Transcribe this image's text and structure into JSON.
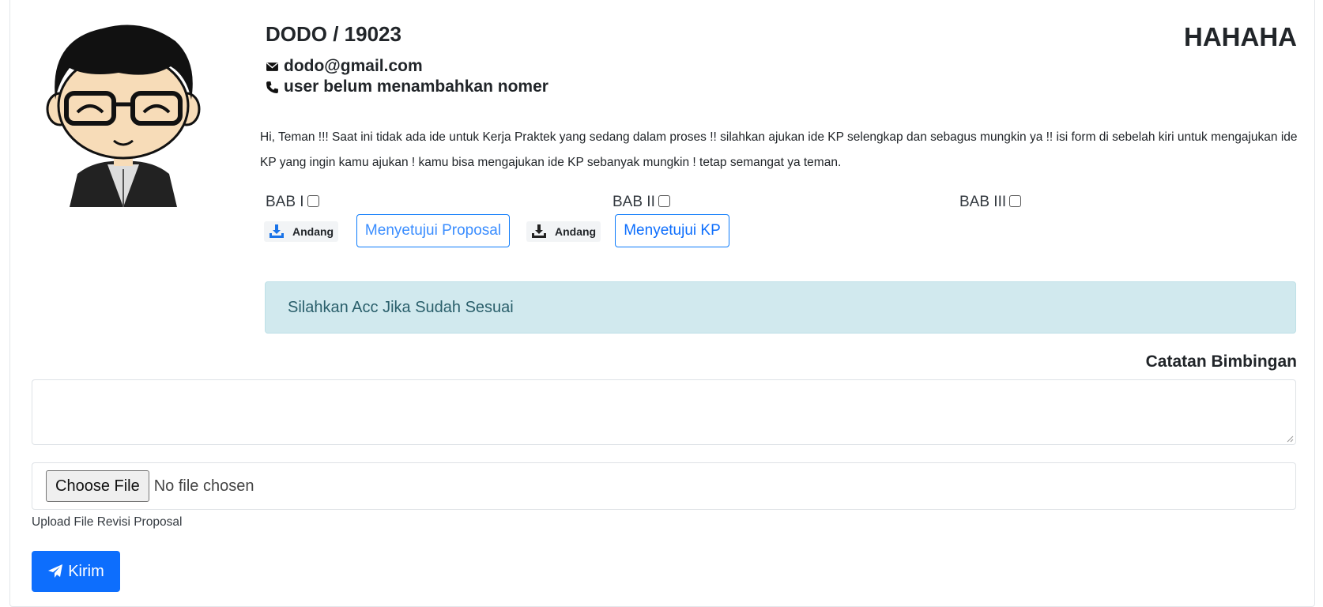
{
  "profile": {
    "name_id": "DODO / 19023",
    "email": "dodo@gmail.com",
    "phone": "user belum menambahkan nomer",
    "title": "HAHAHA"
  },
  "intro_text": "Hi, Teman !!! Saat ini tidak ada ide untuk Kerja Praktek yang sedang dalam proses !! silahkan ajukan ide KP selengkap dan sebagus mungkin ya !! isi form di sebelah kiri untuk mengajukan ide KP yang ingin kamu ajukan ! kamu bisa mengajukan ide KP sebanyak mungkin ! tetap semangat ya teman.",
  "chapters": [
    {
      "label": "BAB I",
      "checked": false
    },
    {
      "label": "BAB II",
      "checked": false
    },
    {
      "label": "BAB III",
      "checked": false
    }
  ],
  "actions": {
    "download_1": "Andang",
    "approve_proposal": "Menyetujui Proposal",
    "download_2": "Andang",
    "approve_kp": "Menyetujui KP"
  },
  "alert_text": "Silahkan Acc Jika Sudah Sesuai",
  "notes": {
    "label": "Catatan Bimbingan",
    "value": ""
  },
  "file_upload": {
    "button": "Choose File",
    "status": "No file chosen",
    "help": "Upload File Revisi Proposal"
  },
  "submit_label": "Kirim",
  "colors": {
    "primary": "#0d6efd",
    "alert_bg": "#d1e9ee",
    "alert_text": "#2a5f6b",
    "download_icon_1": "#1a73e8",
    "download_icon_2": "#222222"
  }
}
